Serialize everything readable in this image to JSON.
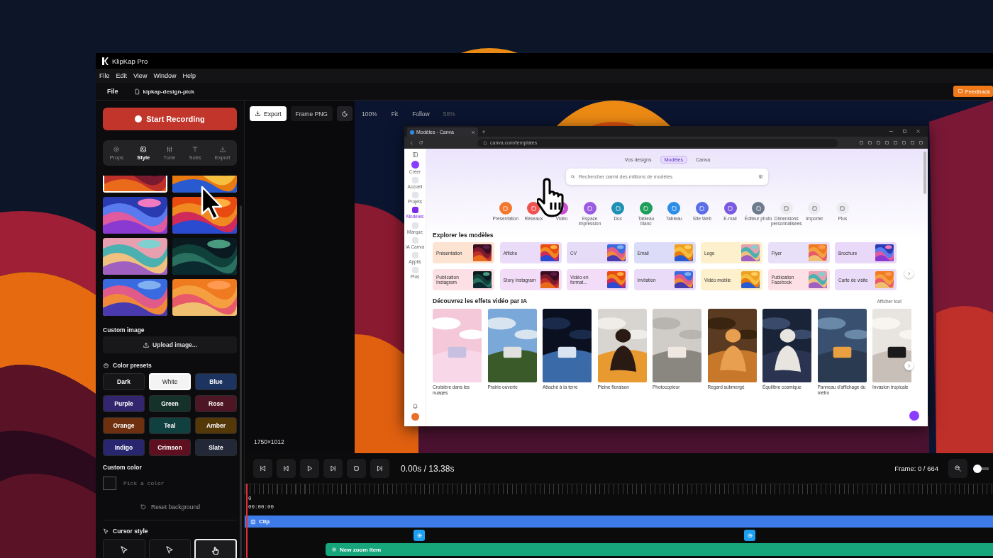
{
  "window": {
    "title": "KlipKap Pro"
  },
  "menu": [
    "File",
    "Edit",
    "View",
    "Window",
    "Help"
  ],
  "file_bar": {
    "label": "File",
    "document": "kipkap-design-pick",
    "feedback": "Feedback"
  },
  "sidebar": {
    "record_button": "Start Recording",
    "tabs": [
      {
        "label": "Props",
        "selected": false
      },
      {
        "label": "Style",
        "selected": true
      },
      {
        "label": "Tune",
        "selected": false
      },
      {
        "label": "Subs",
        "selected": false
      },
      {
        "label": "Export",
        "selected": false
      }
    ],
    "wallpapers": [
      {
        "selected": true
      },
      {
        "selected": false
      },
      {
        "selected": false
      },
      {
        "selected": false
      },
      {
        "selected": false
      },
      {
        "selected": false
      },
      {
        "selected": false
      },
      {
        "selected": false
      }
    ],
    "custom_image": {
      "heading": "Custom image",
      "button": "Upload image..."
    },
    "color_presets": {
      "heading": "Color presets",
      "items": [
        {
          "label": "Dark",
          "color": "#161618",
          "selected": false
        },
        {
          "label": "White",
          "color": "#f4f4f4",
          "selected": true
        },
        {
          "label": "Blue",
          "color": "#1d3461",
          "selected": false
        },
        {
          "label": "Purple",
          "color": "#33256e",
          "selected": false
        },
        {
          "label": "Green",
          "color": "#143229",
          "selected": false
        },
        {
          "label": "Rose",
          "color": "#4e1524",
          "selected": false
        },
        {
          "label": "Orange",
          "color": "#6e300e",
          "selected": false
        },
        {
          "label": "Teal",
          "color": "#10403f",
          "selected": false
        },
        {
          "label": "Amber",
          "color": "#553807",
          "selected": false
        },
        {
          "label": "Indigo",
          "color": "#27266e",
          "selected": false
        },
        {
          "label": "Crimson",
          "color": "#5e0f20",
          "selected": false
        },
        {
          "label": "Slate",
          "color": "#232838",
          "selected": false
        }
      ]
    },
    "custom_color": {
      "heading": "Custom color",
      "placeholder": "Pick a color"
    },
    "reset_button": "Reset background",
    "cursor_style": {
      "heading": "Cursor style",
      "options": [
        {
          "kind": "arrow",
          "selected": false
        },
        {
          "kind": "arrow",
          "selected": false
        },
        {
          "kind": "hand",
          "selected": true
        }
      ]
    }
  },
  "toolbar": {
    "export_button": "Export",
    "frame_button": "Frame PNG",
    "zoom_options": [
      "100%",
      "Fit",
      "Follow"
    ],
    "zoom_level": "58%"
  },
  "preview": {
    "dimensions": "1750×1012",
    "browser": {
      "tab": "Modèles - Canva",
      "url": "canva.com/templates",
      "rail": [
        {
          "label": "Créer",
          "selected": false
        },
        {
          "label": "Accueil",
          "selected": false
        },
        {
          "label": "Projets",
          "selected": false
        },
        {
          "label": "Modèles",
          "selected": true
        },
        {
          "label": "Marque",
          "selected": false
        },
        {
          "label": "IA Canva",
          "selected": false
        },
        {
          "label": "Applis",
          "selected": false
        },
        {
          "label": "Plus",
          "selected": false
        }
      ],
      "pills": [
        {
          "label": "Vos designs",
          "selected": false
        },
        {
          "label": "Modèles",
          "selected": true
        },
        {
          "label": "Canva",
          "selected": false
        }
      ],
      "search_placeholder": "Rechercher parmi des millions de modèles",
      "shortcuts": [
        {
          "label": "Présentation",
          "color": "#f4772e"
        },
        {
          "label": "Réseaux",
          "color": "#ef5350"
        },
        {
          "label": "Vidéo",
          "color": "#c94fd2"
        },
        {
          "label": "Espace impression",
          "color": "#9b5be0"
        },
        {
          "label": "Doc",
          "color": "#1f8fb3"
        },
        {
          "label": "Tableau blanc",
          "color": "#1e9e5a"
        },
        {
          "label": "Tableau",
          "color": "#2b8de8"
        },
        {
          "label": "Site Web",
          "color": "#5b6ee8"
        },
        {
          "label": "E-mail",
          "color": "#7a58e0"
        },
        {
          "label": "Éditeur photo",
          "color": "#6d7b8c"
        },
        {
          "label": "Dimensions personnalisées",
          "color": "#ececf0"
        },
        {
          "label": "Importer",
          "color": "#ececf0"
        },
        {
          "label": "Plus",
          "color": "#ececf0"
        }
      ],
      "templates_heading": "Explorer les modèles",
      "templates": [
        {
          "label": "Présentation",
          "color": "#fde3d2"
        },
        {
          "label": "Affiche",
          "color": "#eadcf8"
        },
        {
          "label": "CV",
          "color": "#e6dcf8"
        },
        {
          "label": "Email",
          "color": "#dcdcf8"
        },
        {
          "label": "Logo",
          "color": "#fdf0cc"
        },
        {
          "label": "Flyer",
          "color": "#e8e0f8"
        },
        {
          "label": "Brochure",
          "color": "#ead8f8"
        },
        {
          "label": "Publication Instagram",
          "color": "#fde0e6"
        },
        {
          "label": "Story Instagram",
          "color": "#f3dcf8"
        },
        {
          "label": "Vidéo en format...",
          "color": "#f3dcf8"
        },
        {
          "label": "Invitation",
          "color": "#eadcf8"
        },
        {
          "label": "Vidéo mobile",
          "color": "#fdf0cc"
        },
        {
          "label": "Publication Facebook",
          "color": "#fde0e6"
        },
        {
          "label": "Carte de visite",
          "color": "#eadcf8"
        }
      ],
      "effects_heading": "Découvrez les effets vidéo par IA",
      "show_all": "Afficher tout",
      "videos": [
        {
          "caption": "Croisière dans les nuages"
        },
        {
          "caption": "Prairie ouverte"
        },
        {
          "caption": "Attaché à la terre"
        },
        {
          "caption": "Pleine floraison"
        },
        {
          "caption": "Photocopieur"
        },
        {
          "caption": "Regard submergé"
        },
        {
          "caption": "Équilibre cosmique"
        },
        {
          "caption": "Panneau d'affichage du métro"
        },
        {
          "caption": "Invasion tropicale"
        }
      ]
    }
  },
  "transport": {
    "time": "0.00s / 13.38s",
    "frame": "Frame: 0 / 664",
    "zoom_slider": {
      "level": 0.2
    }
  },
  "timeline": {
    "ruler_start": "0",
    "timecode": "00:00:00",
    "clip": "Clip",
    "zoom_item": "New zoom item"
  }
}
